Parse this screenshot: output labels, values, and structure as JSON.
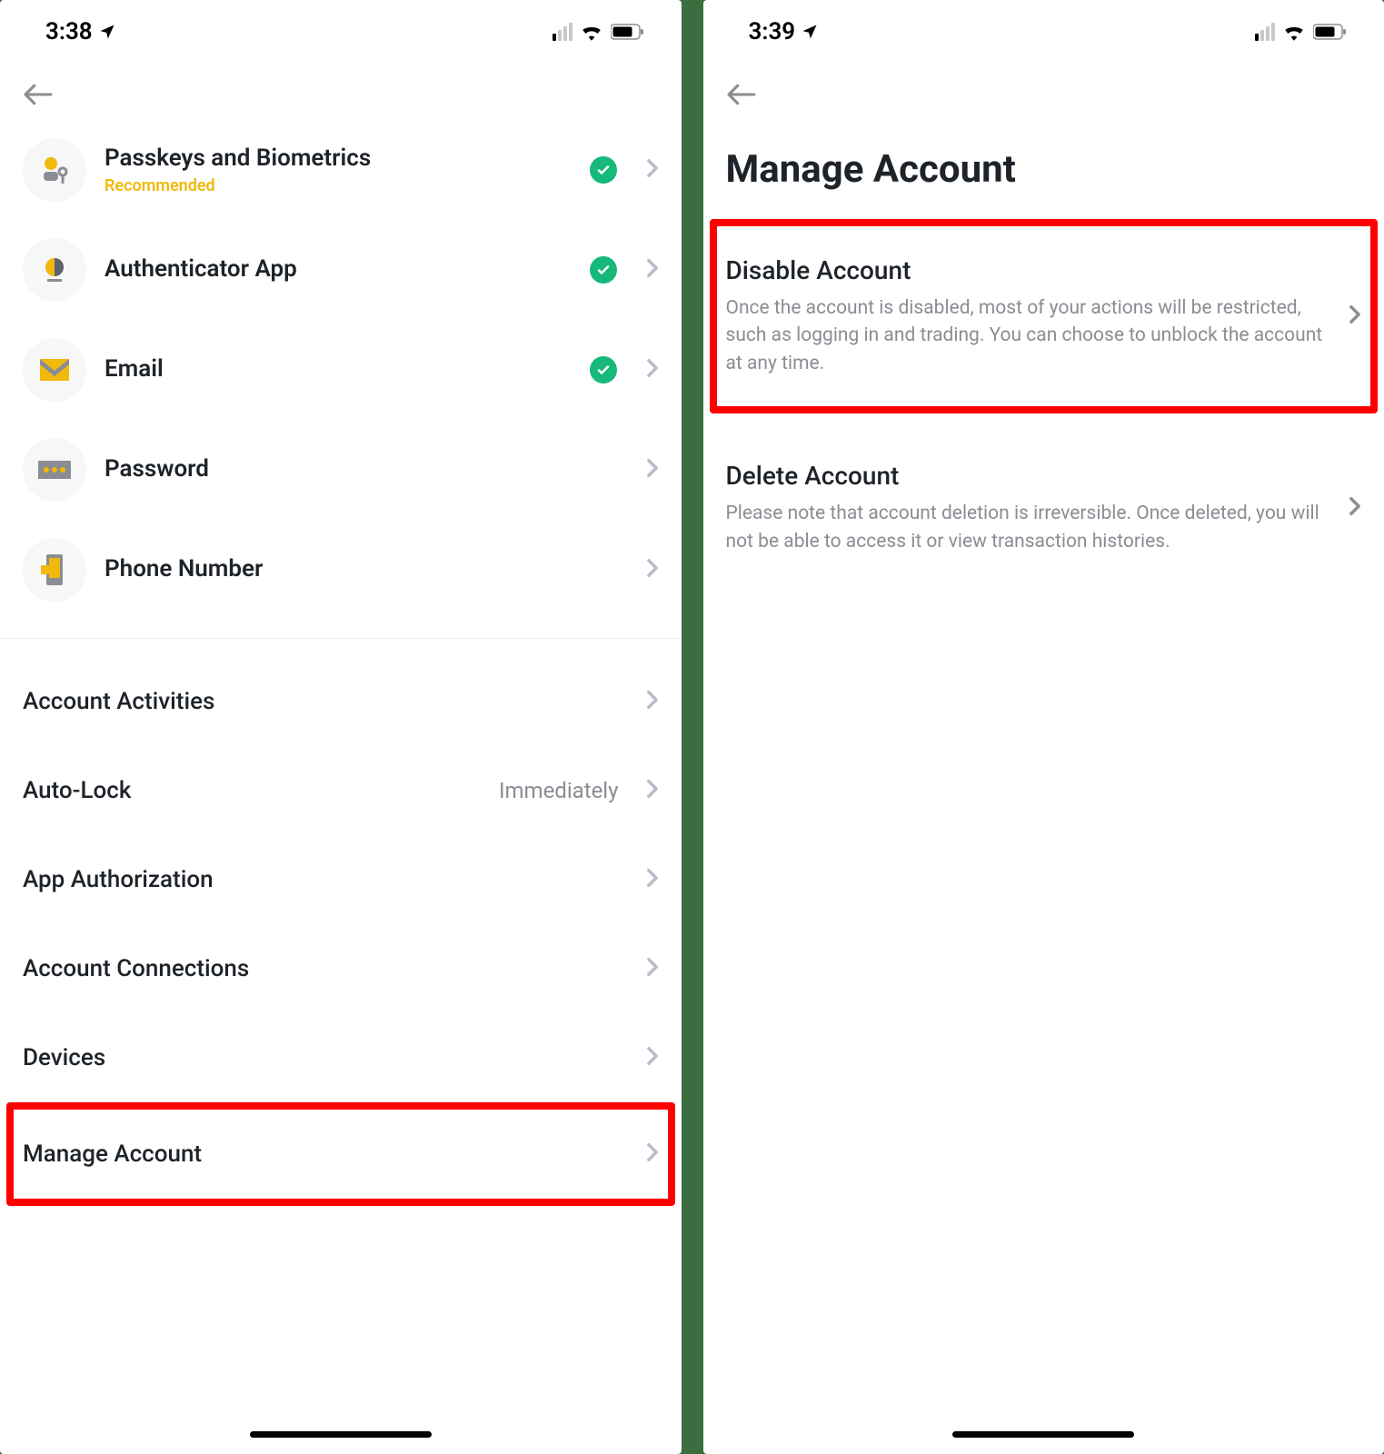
{
  "left": {
    "status": {
      "time": "3:38"
    },
    "security_items": [
      {
        "title": "Passkeys and Biometrics",
        "sub": "Recommended",
        "checked": true
      },
      {
        "title": "Authenticator App",
        "sub": "",
        "checked": true
      },
      {
        "title": "Email",
        "sub": "",
        "checked": true
      },
      {
        "title": "Password",
        "sub": "",
        "checked": false
      },
      {
        "title": "Phone Number",
        "sub": "",
        "checked": false
      }
    ],
    "settings": [
      {
        "title": "Account Activities",
        "value": ""
      },
      {
        "title": "Auto-Lock",
        "value": "Immediately"
      },
      {
        "title": "App Authorization",
        "value": ""
      },
      {
        "title": "Account Connections",
        "value": ""
      },
      {
        "title": "Devices",
        "value": ""
      },
      {
        "title": "Manage Account",
        "value": "",
        "highlight": true
      }
    ]
  },
  "right": {
    "status": {
      "time": "3:39"
    },
    "page_title": "Manage Account",
    "cards": [
      {
        "title": "Disable Account",
        "desc": "Once the account is disabled, most of your actions will be restricted, such as logging in and trading. You can choose to unblock the account at any time.",
        "highlight": true
      },
      {
        "title": "Delete Account",
        "desc": "Please note that account deletion is irreversible. Once deleted, you will not be able to access it or view transaction histories.",
        "highlight": false
      }
    ]
  }
}
